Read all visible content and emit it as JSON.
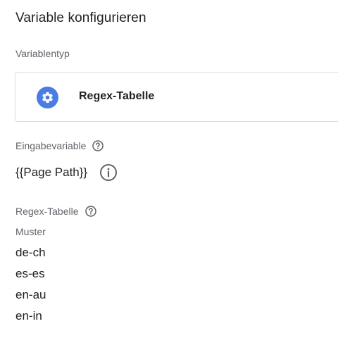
{
  "header": {
    "title": "Variable konfigurieren"
  },
  "variable_type": {
    "section_label": "Variablentyp",
    "name": "Regex-Tabelle",
    "icon": "gear-icon",
    "icon_color": "#4a7ce3"
  },
  "input_variable": {
    "label": "Eingabevariable",
    "value": "{{Page Path}}"
  },
  "regex_table": {
    "label": "Regex-Tabelle",
    "column_header": "Muster",
    "patterns": [
      "de-ch",
      "es-es",
      "en-au",
      "en-in"
    ]
  }
}
